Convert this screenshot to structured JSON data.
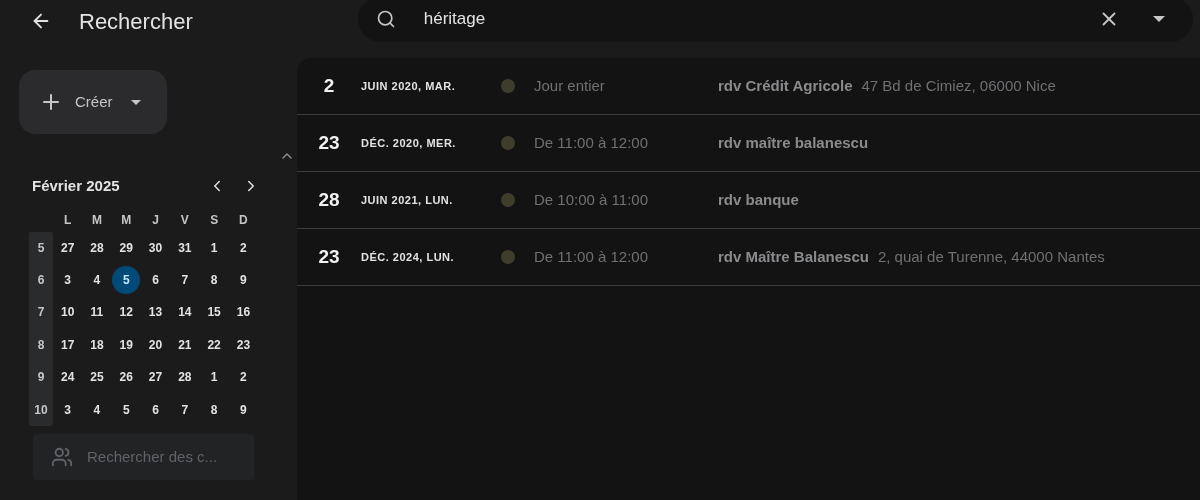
{
  "header": {
    "title": "Rechercher"
  },
  "search": {
    "value": "héritage"
  },
  "create_button": {
    "label": "Créer"
  },
  "mini_calendar": {
    "month": "Février 2025",
    "weekdays": [
      "L",
      "M",
      "M",
      "J",
      "V",
      "S",
      "D"
    ],
    "weeks": [
      {
        "number": "5",
        "days": [
          {
            "label": "27",
            "selected": false
          },
          {
            "label": "28",
            "selected": false
          },
          {
            "label": "29",
            "selected": false
          },
          {
            "label": "30",
            "selected": false
          },
          {
            "label": "31",
            "selected": false
          },
          {
            "label": "1",
            "selected": false
          },
          {
            "label": "2",
            "selected": false
          }
        ]
      },
      {
        "number": "6",
        "days": [
          {
            "label": "3",
            "selected": false
          },
          {
            "label": "4",
            "selected": false
          },
          {
            "label": "5",
            "selected": true
          },
          {
            "label": "6",
            "selected": false
          },
          {
            "label": "7",
            "selected": false
          },
          {
            "label": "8",
            "selected": false
          },
          {
            "label": "9",
            "selected": false
          }
        ]
      },
      {
        "number": "7",
        "days": [
          {
            "label": "10",
            "selected": false
          },
          {
            "label": "11",
            "selected": false
          },
          {
            "label": "12",
            "selected": false
          },
          {
            "label": "13",
            "selected": false
          },
          {
            "label": "14",
            "selected": false
          },
          {
            "label": "15",
            "selected": false
          },
          {
            "label": "16",
            "selected": false
          }
        ]
      },
      {
        "number": "8",
        "days": [
          {
            "label": "17",
            "selected": false
          },
          {
            "label": "18",
            "selected": false
          },
          {
            "label": "19",
            "selected": false
          },
          {
            "label": "20",
            "selected": false
          },
          {
            "label": "21",
            "selected": false
          },
          {
            "label": "22",
            "selected": false
          },
          {
            "label": "23",
            "selected": false
          }
        ]
      },
      {
        "number": "9",
        "days": [
          {
            "label": "24",
            "selected": false
          },
          {
            "label": "25",
            "selected": false
          },
          {
            "label": "26",
            "selected": false
          },
          {
            "label": "27",
            "selected": false
          },
          {
            "label": "28",
            "selected": false
          },
          {
            "label": "1",
            "selected": false
          },
          {
            "label": "2",
            "selected": false
          }
        ]
      },
      {
        "number": "10",
        "days": [
          {
            "label": "3",
            "selected": false
          },
          {
            "label": "4",
            "selected": false
          },
          {
            "label": "5",
            "selected": false
          },
          {
            "label": "6",
            "selected": false
          },
          {
            "label": "7",
            "selected": false
          },
          {
            "label": "8",
            "selected": false
          },
          {
            "label": "9",
            "selected": false
          }
        ]
      }
    ]
  },
  "people_search": {
    "placeholder": "Rechercher des c..."
  },
  "results": [
    {
      "day": "2",
      "date": "JUIN 2020, MAR.",
      "color": "#3e3d2c",
      "time": "Jour entier",
      "title": "rdv Crédit Agricole",
      "location": "47 Bd de Cimiez, 06000 Nice"
    },
    {
      "day": "23",
      "date": "DÉC. 2020, MER.",
      "color": "#3e3d2c",
      "time": "De 11:00 à 12:00",
      "title": "rdv maître balanescu"
    },
    {
      "day": "28",
      "date": "JUIN 2021, LUN.",
      "color": "#3e3d2c",
      "time": "De 10:00 à 11:00",
      "title": "rdv banque"
    },
    {
      "day": "23",
      "date": "DÉC. 2024, LUN.",
      "color": "#3e3d2c",
      "time": "De 11:00 à 12:00",
      "title": "rdv Maître Balanescu",
      "location": "2, quai de Turenne, 44000 Nantes"
    }
  ]
}
